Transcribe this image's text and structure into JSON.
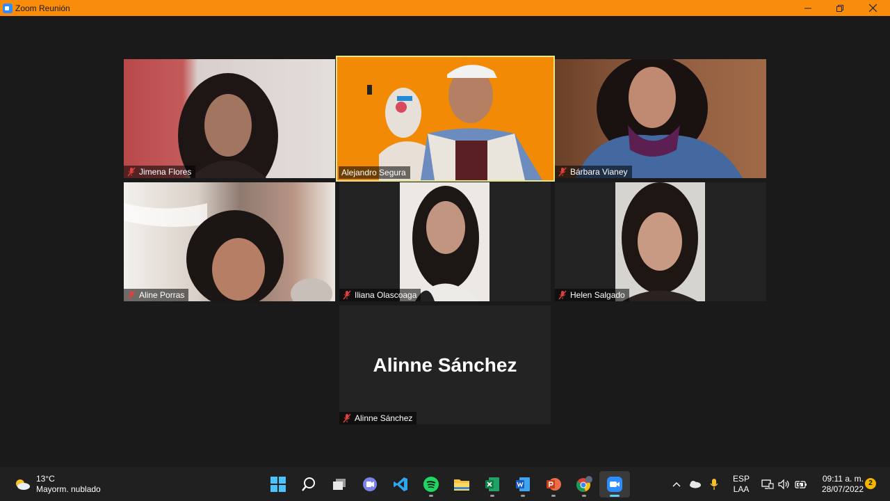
{
  "window": {
    "title": "Zoom Reunión"
  },
  "participants": [
    {
      "name": "Jimena Flores",
      "muted": true
    },
    {
      "name": "Alejandro Segura",
      "muted": true,
      "active_speaker": true
    },
    {
      "name": "Bárbara Vianey",
      "muted": true
    },
    {
      "name": "Aline Porras",
      "muted": true
    },
    {
      "name": "Iliana Olascoaga",
      "muted": true
    },
    {
      "name": "Helen Salgado",
      "muted": true
    },
    {
      "name": "Alinne Sánchez",
      "muted": true,
      "video_off": true,
      "display_name_large": "Alinne Sánchez"
    }
  ],
  "taskbar": {
    "weather": {
      "temp": "13°C",
      "condition": "Mayorm. nublado",
      "icon": "partly-cloudy-icon"
    },
    "apps": [
      {
        "name": "windows-start-icon",
        "running": false
      },
      {
        "name": "search-icon",
        "running": false
      },
      {
        "name": "task-view-icon",
        "running": false
      },
      {
        "name": "teams-chat-icon",
        "running": false
      },
      {
        "name": "vscode-icon",
        "running": false
      },
      {
        "name": "spotify-icon",
        "running": true
      },
      {
        "name": "file-explorer-icon",
        "running": false
      },
      {
        "name": "excel-icon",
        "running": true
      },
      {
        "name": "word-icon",
        "running": true
      },
      {
        "name": "powerpoint-icon",
        "running": true
      },
      {
        "name": "chrome-icon",
        "running": true
      },
      {
        "name": "zoom-icon",
        "running": true,
        "focused": true
      }
    ],
    "tray": {
      "lang_top": "ESP",
      "lang_bottom": "LAA"
    },
    "clock": {
      "time": "09:11 a. m.",
      "date": "28/07/2022"
    },
    "notifications": "2"
  },
  "colors": {
    "titlebar": "#f98c0b",
    "active_border": "#e6e58a",
    "stage": "#1a1a1a",
    "taskbar": "#202020"
  }
}
